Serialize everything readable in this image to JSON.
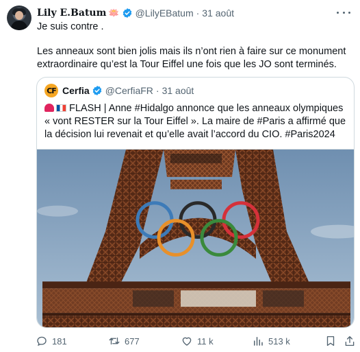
{
  "tweet": {
    "display_name": "Lily E.Batum",
    "name_emoji": "🪷",
    "handle": "@LilyEBatum",
    "separator": "·",
    "date": "31 août",
    "text_line1": "Je suis contre .",
    "text_paragraph": "Les anneaux sont bien jolis mais ils n’ont rien à faire sur ce monument extraordinaire qu’est la Tour Eiffel une fois que les JO sont terminés."
  },
  "quote": {
    "display_name": "Cerfia",
    "handle": "@CerfiaFR",
    "separator": "·",
    "date": "31 août",
    "text": "FLASH | Anne #Hidalgo annonce que les anneaux olympiques « vont RESTER sur la Tour Eiffel ». La maire de #Paris a affirmé que la décision lui revenait et qu’elle avait l’accord du CIO. #Paris2024",
    "avatar_letters": "CF"
  },
  "actions": {
    "replies": "181",
    "retweets": "677",
    "likes": "11 k",
    "views": "513 k"
  },
  "colors": {
    "text": "#0f1419",
    "muted": "#536471",
    "verified": "#1d9bf0",
    "ring_blue": "#3d7bb8",
    "ring_black": "#2a2a2a",
    "ring_red": "#d5313a",
    "ring_yellow": "#e8902a",
    "ring_green": "#3a8a3c"
  }
}
